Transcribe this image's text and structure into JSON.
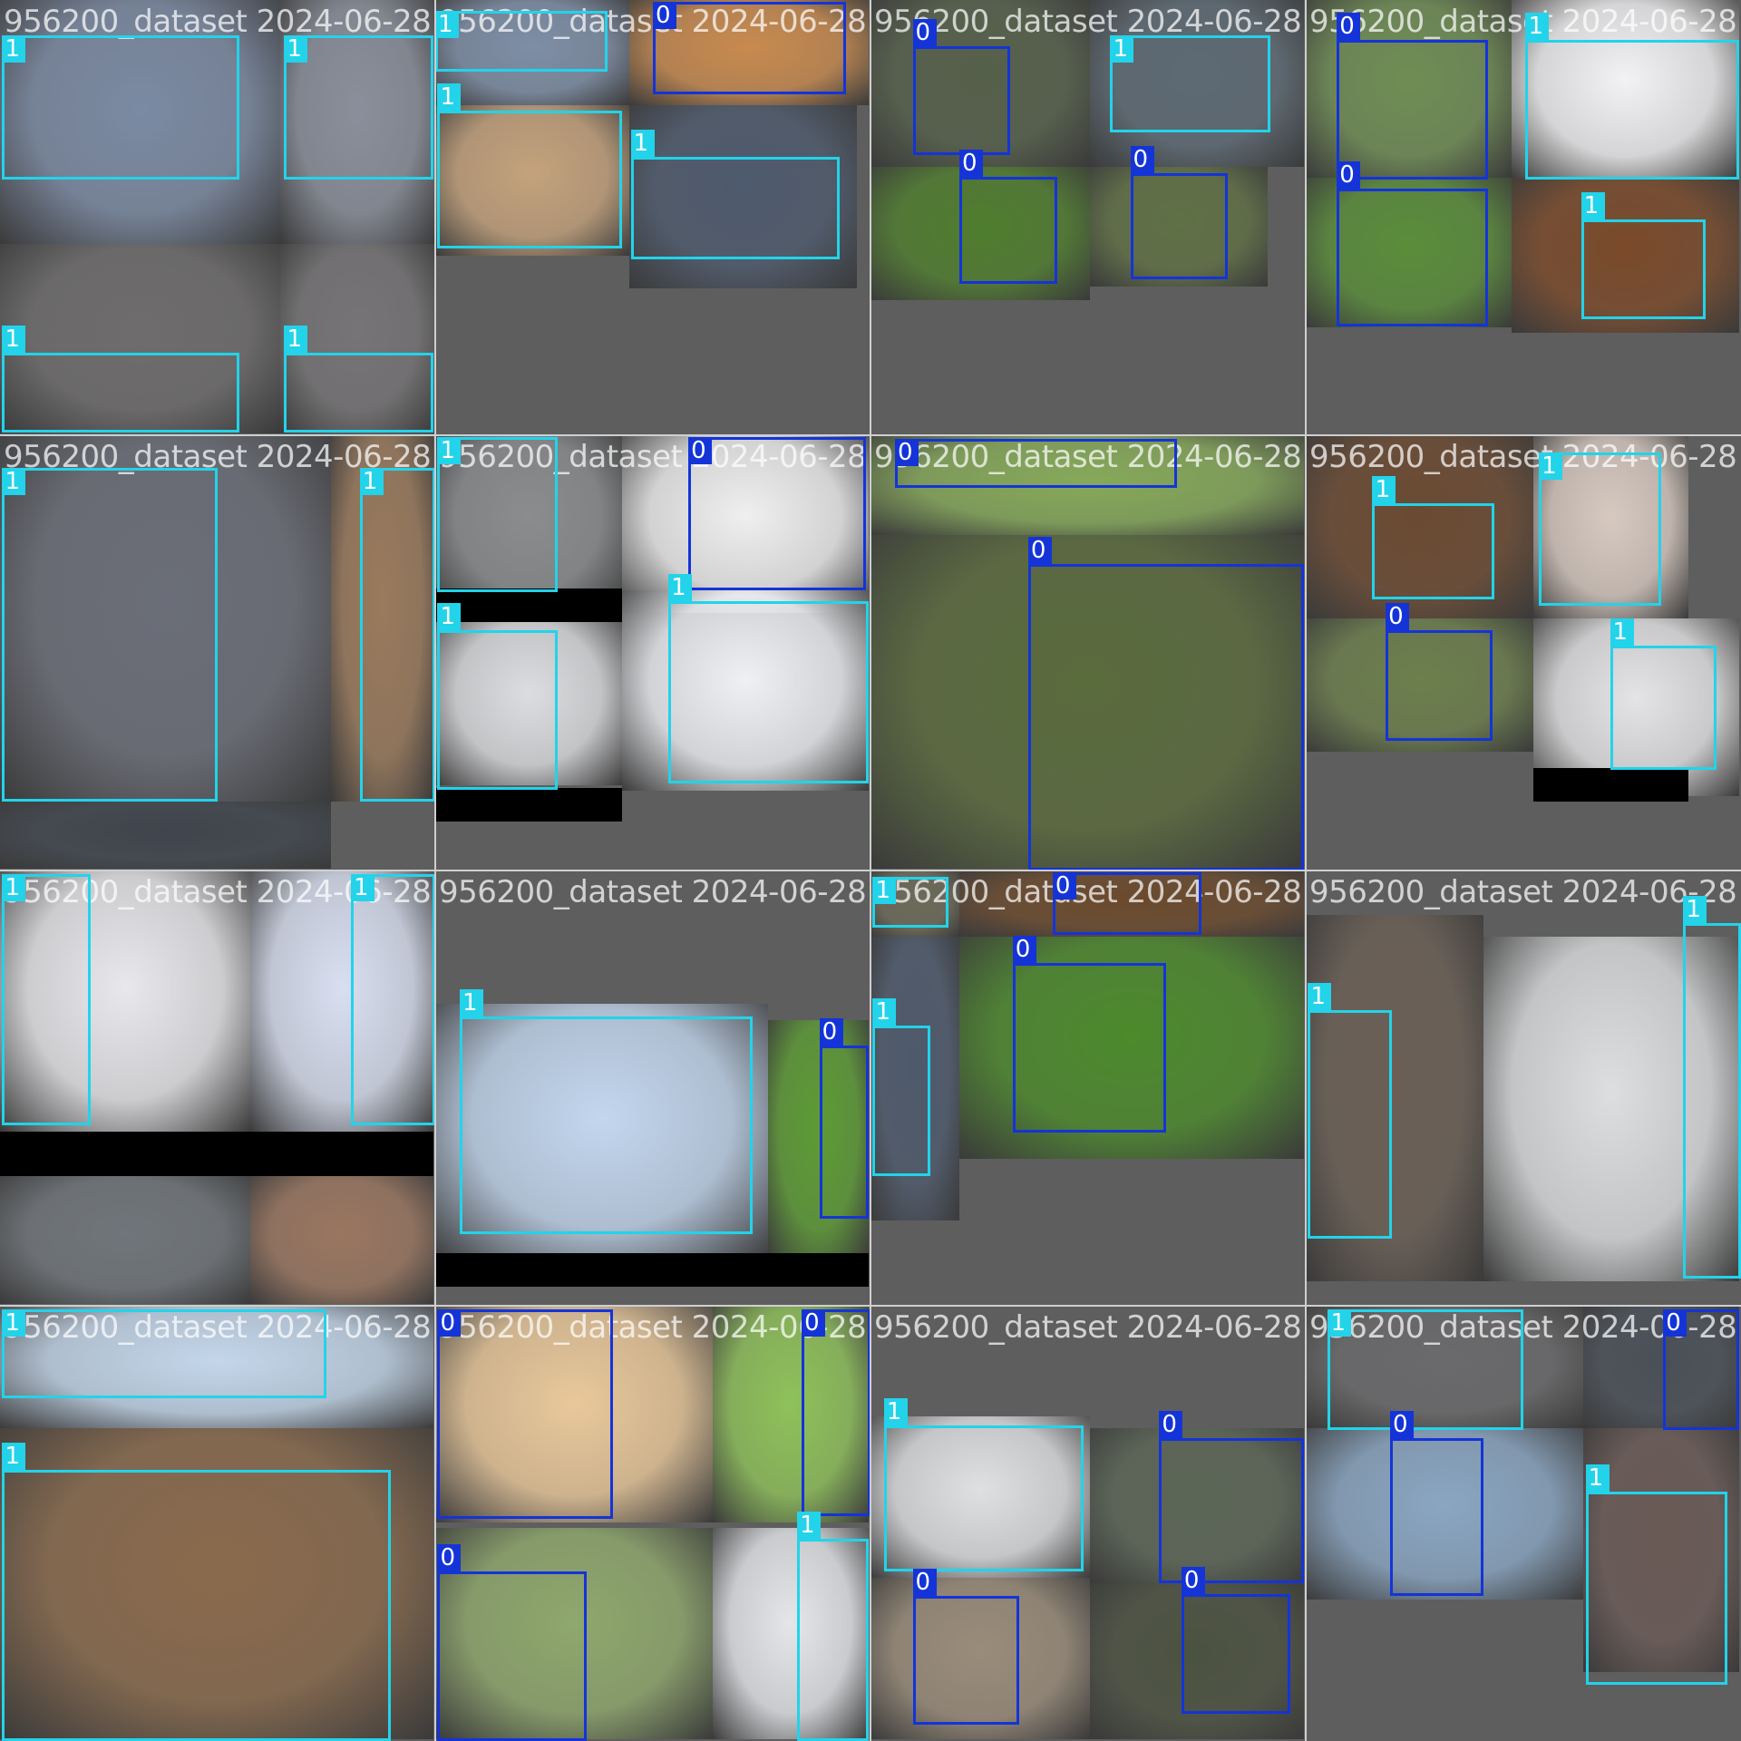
{
  "colors": {
    "class_0": "#1434d8",
    "class_1": "#22d3ea",
    "background": "#727272"
  },
  "class_labels": [
    "0",
    "1"
  ],
  "titles": [
    "956200_dataset 2024-06-28",
    "956200_dataset 2024-06-28",
    "956200_dataset 2024-06-28",
    "956200_dataset 2024-06-28",
    "956200_dataset 2024-06-28",
    "956200_dataset 2024-06-28",
    "956200_dataset 2024-06-28",
    "956200_dataset 2024-06-28",
    "956200_dataset 2024-06-28",
    "956200_dataset 2024-06-28",
    "956200_dataset 2024-06-28",
    "956200_dataset 2024-06-28",
    "956200_dataset 2024-06-28",
    "956200_dataset 2024-06-28",
    "956200_dataset 2024-06-28",
    "956200_dataset 2024-06-28"
  ],
  "image_content": "4x4 mosaic of cat and dog photos with bounding boxes: class 0 (dogs, dark blue) and class 1 (cats, cyan)"
}
